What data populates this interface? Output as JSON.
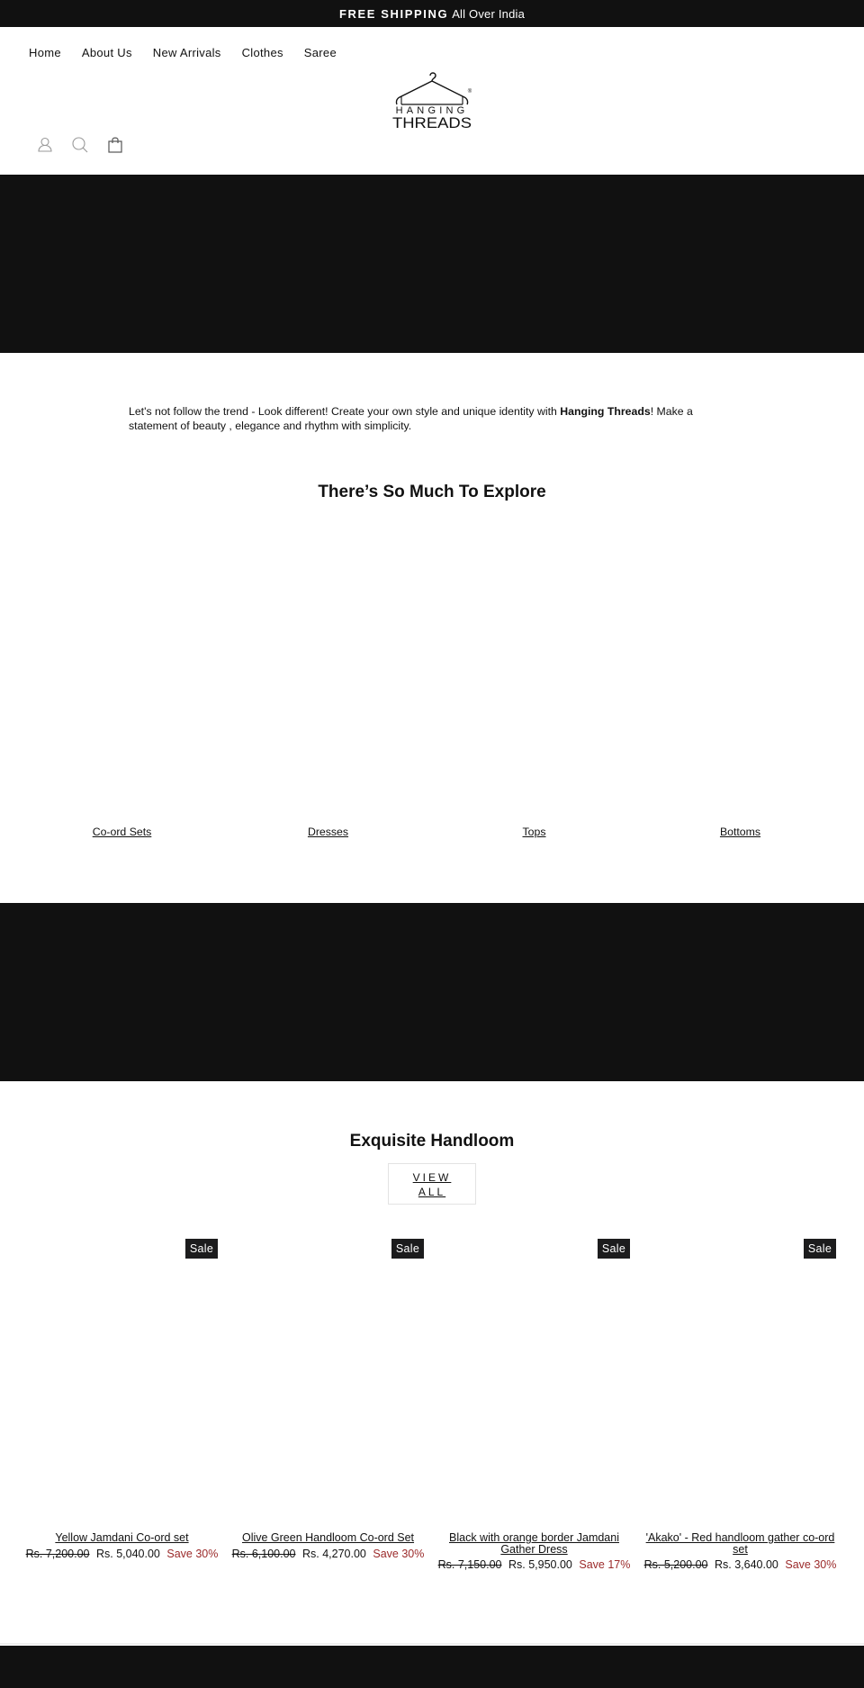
{
  "announcement": {
    "bold": "FREE SHIPPING",
    "text": "All Over India"
  },
  "nav": {
    "items": [
      {
        "label": "Home"
      },
      {
        "label": "About Us"
      },
      {
        "label": "New Arrivals"
      },
      {
        "label": "Clothes"
      },
      {
        "label": "Saree"
      }
    ]
  },
  "logo": {
    "line1": "HANGING",
    "line2": "THREADS",
    "mark": "®"
  },
  "header_icons": [
    "account-icon",
    "search-icon",
    "cart-icon"
  ],
  "intro": {
    "before": "Let's not follow the trend - Look different! Create your own style and unique identity with ",
    "brand": "Hanging Threads",
    "after": "! Make a statement of beauty , elegance and rhythm with simplicity."
  },
  "explore": {
    "title": "There’s So Much To Explore",
    "collections": [
      {
        "label": "Co-ord Sets"
      },
      {
        "label": "Dresses"
      },
      {
        "label": "Tops"
      },
      {
        "label": "Bottoms"
      }
    ]
  },
  "featured": {
    "title": "Exquisite Handloom",
    "view_all_line1": "VIEW",
    "view_all_line2": "ALL",
    "badge": "Sale",
    "products": [
      {
        "title": "Yellow Jamdani Co-ord set",
        "old_price": "Rs. 7,200.00",
        "price": "Rs. 5,040.00",
        "save": "Save 30%"
      },
      {
        "title": "Olive Green Handloom Co-ord Set",
        "old_price": "Rs. 6,100.00",
        "price": "Rs. 4,270.00",
        "save": "Save 30%"
      },
      {
        "title": "Black with orange border Jamdani Gather Dress",
        "old_price": "Rs. 7,150.00",
        "price": "Rs. 5,950.00",
        "save": "Save 17%"
      },
      {
        "title": "'Akako' - Red handloom gather co-ord set",
        "old_price": "Rs. 5,200.00",
        "price": "Rs. 3,640.00",
        "save": "Save 30%"
      }
    ]
  },
  "colors": {
    "dark": "#111111",
    "sale_red": "#9b2a2a",
    "badge": "#1c1c1d"
  }
}
